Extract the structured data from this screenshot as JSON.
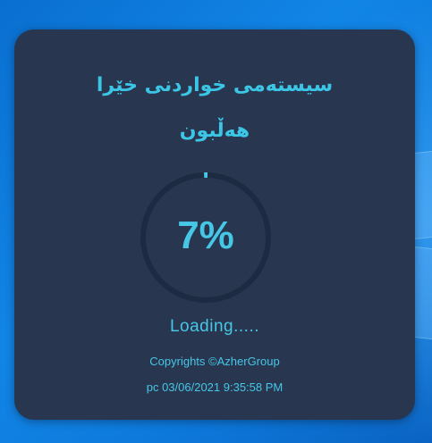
{
  "splash": {
    "title_line1": "سیستەمی خواردنی خێرا",
    "title_line2": "هەڵبون",
    "progress_percent": 7,
    "progress_text": "7%",
    "loading_text": "Loading.....",
    "copyright": "Copyrights ©AzherGroup",
    "timestamp": "pc 03/06/2021 9:35:58 PM"
  },
  "colors": {
    "panel_background": "#283650",
    "accent": "#46c7e6",
    "ring_track": "#1c2a42",
    "desktop_background": "#1185e6"
  }
}
